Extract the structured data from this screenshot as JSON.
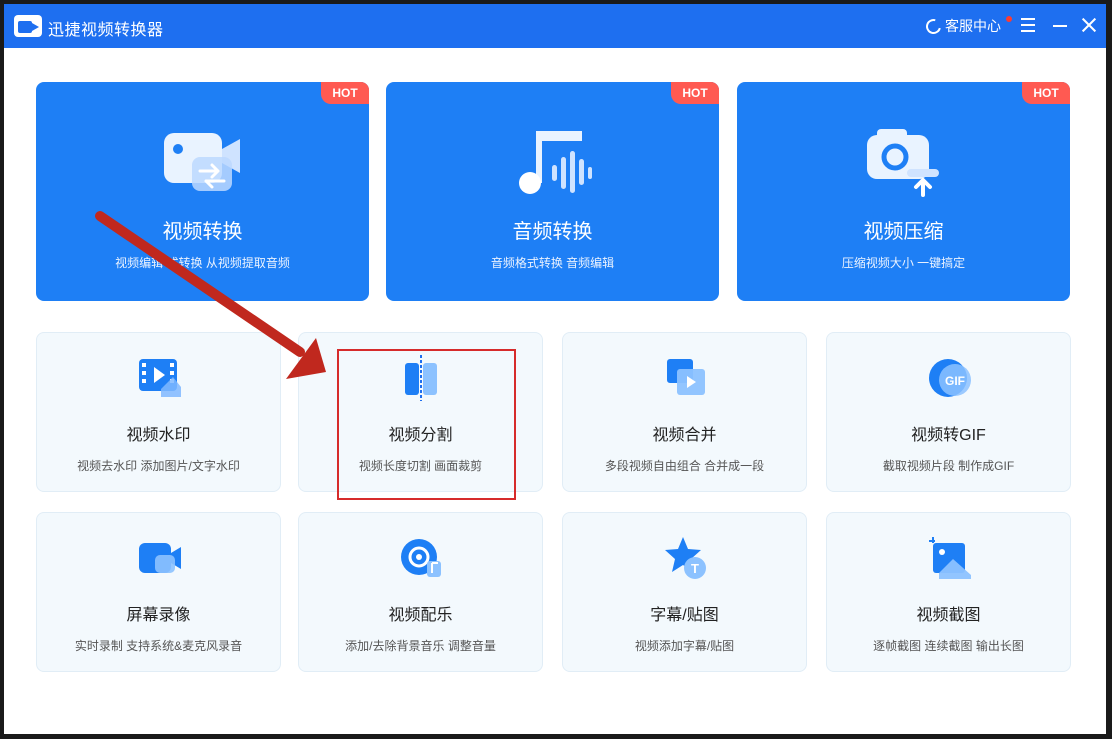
{
  "app": {
    "title": "迅捷视频转换器"
  },
  "header": {
    "service_label": "客服中心"
  },
  "colors": {
    "titlebar": "#1e6ff0",
    "big_card": "#1e7ff5",
    "hot_badge": "#ff5a52",
    "small_card_bg": "#f3f9fd",
    "annotation": "#c0281e"
  },
  "big_cards": [
    {
      "title": "视频转换",
      "desc": "视频编辑  式转换 从视频提取音频",
      "badge": "HOT",
      "icon": "video-convert-icon"
    },
    {
      "title": "音频转换",
      "desc": "音频格式转换 音频编辑",
      "badge": "HOT",
      "icon": "music-note-icon"
    },
    {
      "title": "视频压缩",
      "desc": "压缩视频大小 一键搞定",
      "badge": "HOT",
      "icon": "compress-camera-icon"
    }
  ],
  "small_cards": [
    {
      "title": "视频水印",
      "desc": "视频去水印 添加图片/文字水印",
      "icon": "film-watermark-icon"
    },
    {
      "title": "视频分割",
      "desc": "视频长度切割 画面裁剪",
      "icon": "split-icon"
    },
    {
      "title": "视频合并",
      "desc": "多段视频自由组合 合并成一段",
      "icon": "merge-icon"
    },
    {
      "title": "视频转GIF",
      "desc": "截取视频片段 制作成GIF",
      "icon": "gif-icon",
      "icon_text": "GIF"
    },
    {
      "title": "屏幕录像",
      "desc": "实时录制 支持系统&麦克风录音",
      "icon": "screen-record-icon"
    },
    {
      "title": "视频配乐",
      "desc": "添加/去除背景音乐 调整音量",
      "icon": "music-disc-icon"
    },
    {
      "title": "字幕/贴图",
      "desc": "视频添加字幕/贴图",
      "icon": "subtitle-star-icon",
      "icon_text": "T"
    },
    {
      "title": "视频截图",
      "desc": "逐帧截图 连续截图 输出长图",
      "icon": "screenshot-icon"
    }
  ]
}
